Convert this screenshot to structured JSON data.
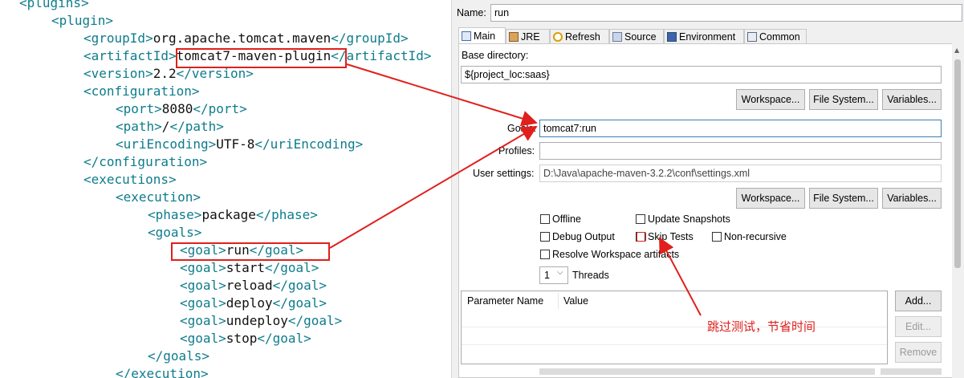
{
  "code": {
    "lines": [
      {
        "open": "<plugins>",
        "text": "",
        "close": ""
      },
      {
        "open": "<plugin>",
        "text": "",
        "close": ""
      },
      {
        "open": "<groupId>",
        "text": "org.apache.tomcat.maven",
        "close": "</groupId>"
      },
      {
        "open": "<artifactId>",
        "text": "tomcat7-maven-plugin",
        "close": "</artifactId>"
      },
      {
        "open": "<version>",
        "text": "2.2",
        "close": "</version>"
      },
      {
        "open": "<configuration>",
        "text": "",
        "close": ""
      },
      {
        "open": "<port>",
        "text": "8080",
        "close": "</port>"
      },
      {
        "open": "<path>",
        "text": "/",
        "close": "</path>"
      },
      {
        "open": "<uriEncoding>",
        "text": "UTF-8",
        "close": "</uriEncoding>"
      },
      {
        "open": "</configuration>",
        "text": "",
        "close": ""
      },
      {
        "open": "<executions>",
        "text": "",
        "close": ""
      },
      {
        "open": "<execution>",
        "text": "",
        "close": ""
      },
      {
        "open": "<phase>",
        "text": "package",
        "close": "</phase>"
      },
      {
        "open": "<goals>",
        "text": "",
        "close": ""
      },
      {
        "open": "<goal>",
        "text": "run",
        "close": "</goal>"
      },
      {
        "open": "<goal>",
        "text": "start",
        "close": "</goal>"
      },
      {
        "open": "<goal>",
        "text": "reload",
        "close": "</goal>"
      },
      {
        "open": "<goal>",
        "text": "deploy",
        "close": "</goal>"
      },
      {
        "open": "<goal>",
        "text": "undeploy",
        "close": "</goal>"
      },
      {
        "open": "<goal>",
        "text": "stop",
        "close": "</goal>"
      },
      {
        "open": "</goals>",
        "text": "",
        "close": ""
      },
      {
        "open": "</execution>",
        "text": "",
        "close": ""
      }
    ]
  },
  "config": {
    "name_label": "Name:",
    "name_value": "run",
    "tabs": [
      {
        "label": "Main",
        "icon": "main-tab-icon",
        "active": true
      },
      {
        "label": "JRE",
        "icon": "jre-icon",
        "active": false
      },
      {
        "label": "Refresh",
        "icon": "refresh-icon",
        "active": false
      },
      {
        "label": "Source",
        "icon": "source-icon",
        "active": false
      },
      {
        "label": "Environment",
        "icon": "environment-icon",
        "active": false
      },
      {
        "label": "Common",
        "icon": "common-icon",
        "active": false
      }
    ],
    "base_dir_label": "Base directory:",
    "base_dir_value": "${project_loc:saas}",
    "workspace_btn": "Workspace...",
    "filesystem_btn": "File System...",
    "variables_btn": "Variables...",
    "goals_label": "Goals:",
    "goals_value": "tomcat7:run",
    "profiles_label": "Profiles:",
    "profiles_value": "",
    "user_settings_label": "User settings:",
    "user_settings_value": "D:\\Java\\apache-maven-3.2.2\\conf\\settings.xml",
    "checkboxes": {
      "offline": {
        "label": "Offline",
        "checked": false
      },
      "update_snapshots": {
        "label": "Update Snapshots",
        "checked": false
      },
      "debug_output": {
        "label": "Debug Output",
        "checked": false
      },
      "skip_tests": {
        "label": "Skip Tests",
        "checked": false
      },
      "non_recursive": {
        "label": "Non-recursive",
        "checked": false
      },
      "resolve_workspace": {
        "label": "Resolve Workspace artifacts",
        "checked": false
      }
    },
    "threads_value": "1",
    "threads_label": "Threads",
    "table": {
      "col_param": "Parameter Name",
      "col_value": "Value"
    },
    "add_btn": "Add...",
    "edit_btn": "Edit...",
    "remove_btn": "Remove"
  },
  "annotation": {
    "note": "跳过测试，节省时间",
    "color": "#e0201c"
  },
  "colors": {
    "xml_tag": "#0e7c8c",
    "panel_bg": "#f0f0f0"
  }
}
